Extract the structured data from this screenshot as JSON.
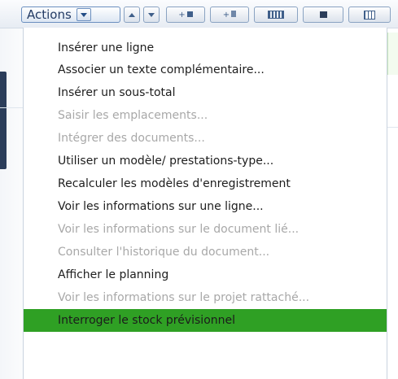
{
  "toolbar": {
    "actions_label": "Actions",
    "buttons": [
      {
        "name": "move-up-button",
        "icon": "arrow-up-icon"
      },
      {
        "name": "move-down-button",
        "icon": "arrow-down-icon"
      },
      {
        "name": "add-line-button",
        "icon": "add-line-icon",
        "glyph": "+"
      },
      {
        "name": "add-document-button",
        "icon": "add-document-icon",
        "glyph": "+"
      },
      {
        "name": "keyboard-button",
        "icon": "keyboard-icon"
      },
      {
        "name": "folder-button",
        "icon": "folder-icon"
      },
      {
        "name": "grid-button",
        "icon": "grid-icon"
      }
    ]
  },
  "menu": {
    "items": [
      {
        "label": "Insérer une ligne",
        "enabled": true
      },
      {
        "label": "Associer un texte complémentaire...",
        "enabled": true
      },
      {
        "label": "Insérer un sous-total",
        "enabled": true
      },
      {
        "label": "Saisir les emplacements...",
        "enabled": false
      },
      {
        "label": "Intégrer des documents...",
        "enabled": false
      },
      {
        "label": "Utiliser un modèle/ prestations-type...",
        "enabled": true
      },
      {
        "label": "Recalculer les modèles d'enregistrement",
        "enabled": true
      },
      {
        "label": "Voir les informations sur une ligne...",
        "enabled": true
      },
      {
        "label": "Voir les informations sur le document lié...",
        "enabled": false
      },
      {
        "label": "Consulter l'historique du document...",
        "enabled": false
      },
      {
        "label": "Afficher le planning",
        "enabled": true
      },
      {
        "label": "Voir les informations sur le projet rattaché...",
        "enabled": false
      },
      {
        "label": "Interroger le stock prévisionnel",
        "enabled": true,
        "selected": true
      }
    ]
  },
  "colors": {
    "selected_background": "#2fa024",
    "disabled_text": "#a8a8a8",
    "enabled_text": "#1d1d1d"
  }
}
